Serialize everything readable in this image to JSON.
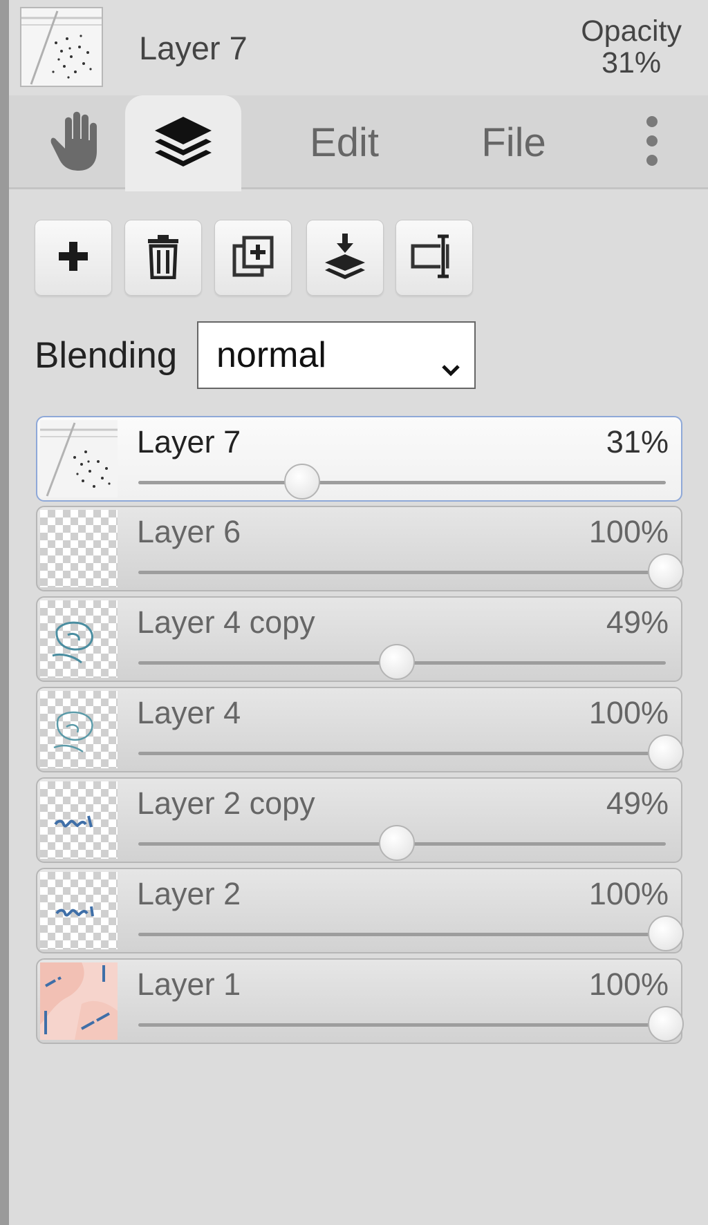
{
  "colors": {
    "panel_bg": "#dcdcdc",
    "selected_border": "#8ea8d8",
    "accent_text": "#333333"
  },
  "header": {
    "layer_name": "Layer 7",
    "opacity_label": "Opacity",
    "opacity_value": "31%"
  },
  "tabs": {
    "hand_icon": "hand-icon",
    "layers_icon": "layers-icon",
    "edit_label": "Edit",
    "file_label": "File",
    "more_icon": "more-vertical-icon"
  },
  "toolbar": {
    "buttons": [
      {
        "icon": "add-layer-icon"
      },
      {
        "icon": "trash-icon"
      },
      {
        "icon": "duplicate-layer-icon"
      },
      {
        "icon": "merge-down-icon"
      },
      {
        "icon": "rename-icon"
      }
    ]
  },
  "blending": {
    "label": "Blending",
    "value": "normal"
  },
  "layers": [
    {
      "name": "Layer 7",
      "opacity_label": "31%",
      "opacity": 0.31,
      "selected": true,
      "thumb": "sketch"
    },
    {
      "name": "Layer 6",
      "opacity_label": "100%",
      "opacity": 1.0,
      "selected": false,
      "thumb": "empty"
    },
    {
      "name": "Layer 4 copy",
      "opacity_label": "49%",
      "opacity": 0.49,
      "selected": false,
      "thumb": "teal"
    },
    {
      "name": "Layer 4",
      "opacity_label": "100%",
      "opacity": 1.0,
      "selected": false,
      "thumb": "teal"
    },
    {
      "name": "Layer 2 copy",
      "opacity_label": "49%",
      "opacity": 0.49,
      "selected": false,
      "thumb": "blue"
    },
    {
      "name": "Layer 2",
      "opacity_label": "100%",
      "opacity": 1.0,
      "selected": false,
      "thumb": "blue"
    },
    {
      "name": "Layer 1",
      "opacity_label": "100%",
      "opacity": 1.0,
      "selected": false,
      "thumb": "pink"
    }
  ]
}
